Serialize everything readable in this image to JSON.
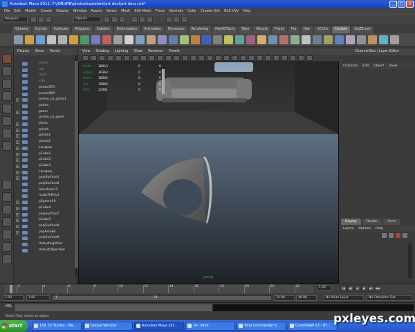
{
  "window": {
    "title": "Autodesk Maya 2011: F:\\JOBURB\\photoshoptalent\\art deci\\art decs.mb*"
  },
  "menu": [
    "File",
    "Edit",
    "Modify",
    "Create",
    "Display",
    "Window",
    "Assets",
    "Select",
    "Mesh",
    "Edit Mesh",
    "Proxy",
    "Normals",
    "Color",
    "Create UVs",
    "Edit UVs",
    "Help"
  ],
  "statusline": {
    "mode": "Polygons",
    "select_field": "Objects"
  },
  "shelf_tabs": [
    "General",
    "Curves",
    "Surfaces",
    "Polygons",
    "Subdivs",
    "Deformation",
    "Animation",
    "Dynamics",
    "Rendering",
    "PaintEffects",
    "Toon",
    "Muscle",
    "Fluids",
    "Fur",
    "Hair",
    "nCloth",
    "Custom",
    "GoZBrush"
  ],
  "shelf_active": "Custom",
  "outliner": {
    "menu": [
      "Display",
      "Show",
      "Panels"
    ],
    "items": [
      {
        "label": "persp",
        "plus": false,
        "dim": true
      },
      {
        "label": "top",
        "plus": false,
        "dim": true
      },
      {
        "label": "front",
        "plus": false,
        "dim": true
      },
      {
        "label": "side",
        "plus": false,
        "dim": true
      },
      {
        "label": "pereteSTG",
        "plus": false,
        "dim": false
      },
      {
        "label": "pereteDRP",
        "plus": false,
        "dim": false
      },
      {
        "label": "perete_cu_geam1",
        "plus": true,
        "dim": false
      },
      {
        "label": "podea",
        "plus": false,
        "dim": false
      },
      {
        "label": "geam",
        "plus": true,
        "dim": false
      },
      {
        "label": "perete_cu_geam",
        "plus": false,
        "dim": false
      },
      {
        "label": "plinta",
        "plus": true,
        "dim": false
      },
      {
        "label": "grinda",
        "plus": true,
        "dim": false
      },
      {
        "label": "grinda1",
        "plus": true,
        "dim": false
      },
      {
        "label": "grinda2",
        "plus": true,
        "dim": false
      },
      {
        "label": "canapea",
        "plus": true,
        "dim": false
      },
      {
        "label": "pCube1",
        "plus": true,
        "dim": false
      },
      {
        "label": "pCube2",
        "plus": true,
        "dim": false
      },
      {
        "label": "pCube3",
        "plus": true,
        "dim": false
      },
      {
        "label": "canapea",
        "plus": true,
        "dim": false
      },
      {
        "label": "polySurface1",
        "plus": true,
        "dim": false
      },
      {
        "label": "polySurface6",
        "plus": false,
        "dim": false
      },
      {
        "label": "transform15",
        "plus": false,
        "dim": false
      },
      {
        "label": "nurbsToPoly1",
        "plus": false,
        "dim": false
      },
      {
        "label": "pSphere59",
        "plus": true,
        "dim": false
      },
      {
        "label": "pCube4",
        "plus": true,
        "dim": false
      },
      {
        "label": "polySurface7",
        "plus": true,
        "dim": false
      },
      {
        "label": "pCube5",
        "plus": true,
        "dim": false
      },
      {
        "label": "polySurface8",
        "plus": true,
        "dim": false
      },
      {
        "label": "pSphere60",
        "plus": true,
        "dim": false
      },
      {
        "label": "polySurface9",
        "plus": false,
        "dim": false
      },
      {
        "label": "defaultLightSet",
        "plus": false,
        "dim": false
      },
      {
        "label": "defaultObjectSet",
        "plus": false,
        "dim": false
      }
    ]
  },
  "viewport": {
    "menu": [
      "View",
      "Shading",
      "Lighting",
      "Show",
      "Renderer",
      "Panels"
    ],
    "hud": [
      {
        "k": "Verts:",
        "v1": "18013",
        "v2": "0",
        "v3": "0"
      },
      {
        "k": "Edges:",
        "v1": "36363",
        "v2": "0",
        "v3": "0"
      },
      {
        "k": "Faces:",
        "v1": "18562",
        "v2": "0",
        "v3": "0"
      },
      {
        "k": "Tris:",
        "v1": "35864",
        "v2": "0",
        "v3": "0"
      },
      {
        "k": "UVs:",
        "v1": "22481",
        "v2": "0",
        "v3": "0"
      }
    ],
    "camera_label": "persp"
  },
  "channel_box": {
    "title": "Channel Box / Layer Editor",
    "menu": [
      "Channels",
      "Edit",
      "Object",
      "Show"
    ]
  },
  "layer_editor": {
    "tabs": [
      "Display",
      "Render",
      "Anim"
    ],
    "menu": [
      "Layers",
      "Options",
      "Help"
    ]
  },
  "timeline": {
    "ticks": [
      "2",
      "4",
      "6",
      "8",
      "10",
      "12",
      "14",
      "16",
      "18",
      "20",
      "22",
      "24"
    ],
    "current_frame": "1.00",
    "playback_buttons": [
      "|◀",
      "◀|",
      "◀",
      "▶",
      "▶|",
      "▶▶|"
    ]
  },
  "range": {
    "start": "1.00",
    "start2": "1.00",
    "slider_start": "1",
    "slider_end": "24",
    "end": "24.00",
    "end2": "48.00",
    "anim_layer": "No Anim Layer",
    "char_set": "No Character Set"
  },
  "cmdline": {
    "label": "MEL"
  },
  "helpline": {
    "text": "Select Tool: select an object"
  },
  "taskbar": {
    "start": "start",
    "tasks": [
      {
        "label": "139, 12 Stories - Wa...",
        "active": false
      },
      {
        "label": "Output Window",
        "active": false
      },
      {
        "label": "Autodesk Maya 201...",
        "active": true
      },
      {
        "label": "14 - Paint",
        "active": false
      },
      {
        "label": "Total Commander 6....",
        "active": false
      },
      {
        "label": "CorelDRAW X3 - [Fr...",
        "active": false
      }
    ]
  },
  "watermark": "pxleyes.com",
  "colors": {
    "hud_key": "#2aa24a",
    "titlebar": "#2c5bd8",
    "taskbar": "#2553c4",
    "start": "#3aa83a"
  }
}
